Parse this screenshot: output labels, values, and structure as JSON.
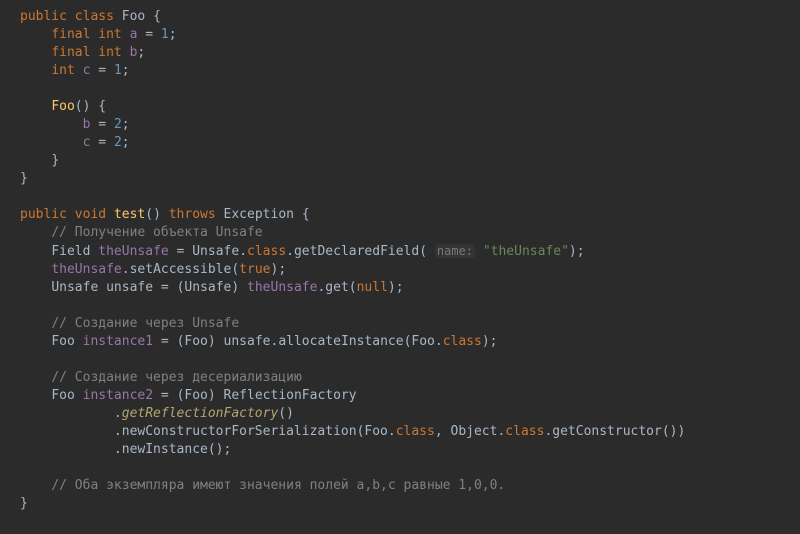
{
  "code": {
    "kw_public": "public",
    "kw_class": "class",
    "kw_final": "final",
    "kw_int": "int",
    "kw_void": "void",
    "kw_throws": "throws",
    "kw_true": "true",
    "kw_null": "null",
    "name_Foo": "Foo",
    "name_Exception": "Exception",
    "name_Field": "Field",
    "name_Unsafe": "Unsafe",
    "name_ReflectionFactory": "ReflectionFactory",
    "name_Object": "Object",
    "var_a": "a",
    "var_b": "b",
    "var_c": "c",
    "var_theUnsafe": "theUnsafe",
    "var_unsafe": "unsafe",
    "var_instance1": "instance1",
    "var_instance2": "instance2",
    "num_1": "1",
    "num_2": "2",
    "meth_test": "test",
    "meth_Foo": "Foo",
    "meth_getDeclaredField": "getDeclaredField",
    "meth_setAccessible": "setAccessible",
    "meth_get": "get",
    "meth_allocateInstance": "allocateInstance",
    "meth_getReflectionFactory": "getReflectionFactory",
    "meth_newConstructorForSerialization": "newConstructorForSerialization",
    "meth_getConstructor": "getConstructor",
    "meth_newInstance": "newInstance",
    "prop_class": "class",
    "hint_name": "name:",
    "str_theUnsafe": "\"theUnsafe\"",
    "cmt1": "// Получение объекта Unsafe",
    "cmt2": "// Создание через Unsafe",
    "cmt3": "// Создание через десериализацию",
    "cmt4": "// Оба экземпляра имеют значения полей a,b,c равные 1,0,0.",
    "brace_open": "{",
    "brace_close": "}",
    "paren_open": "(",
    "paren_close": ")",
    "semi": ";",
    "eq": " = ",
    "dotp": ".",
    "comma": ", "
  }
}
